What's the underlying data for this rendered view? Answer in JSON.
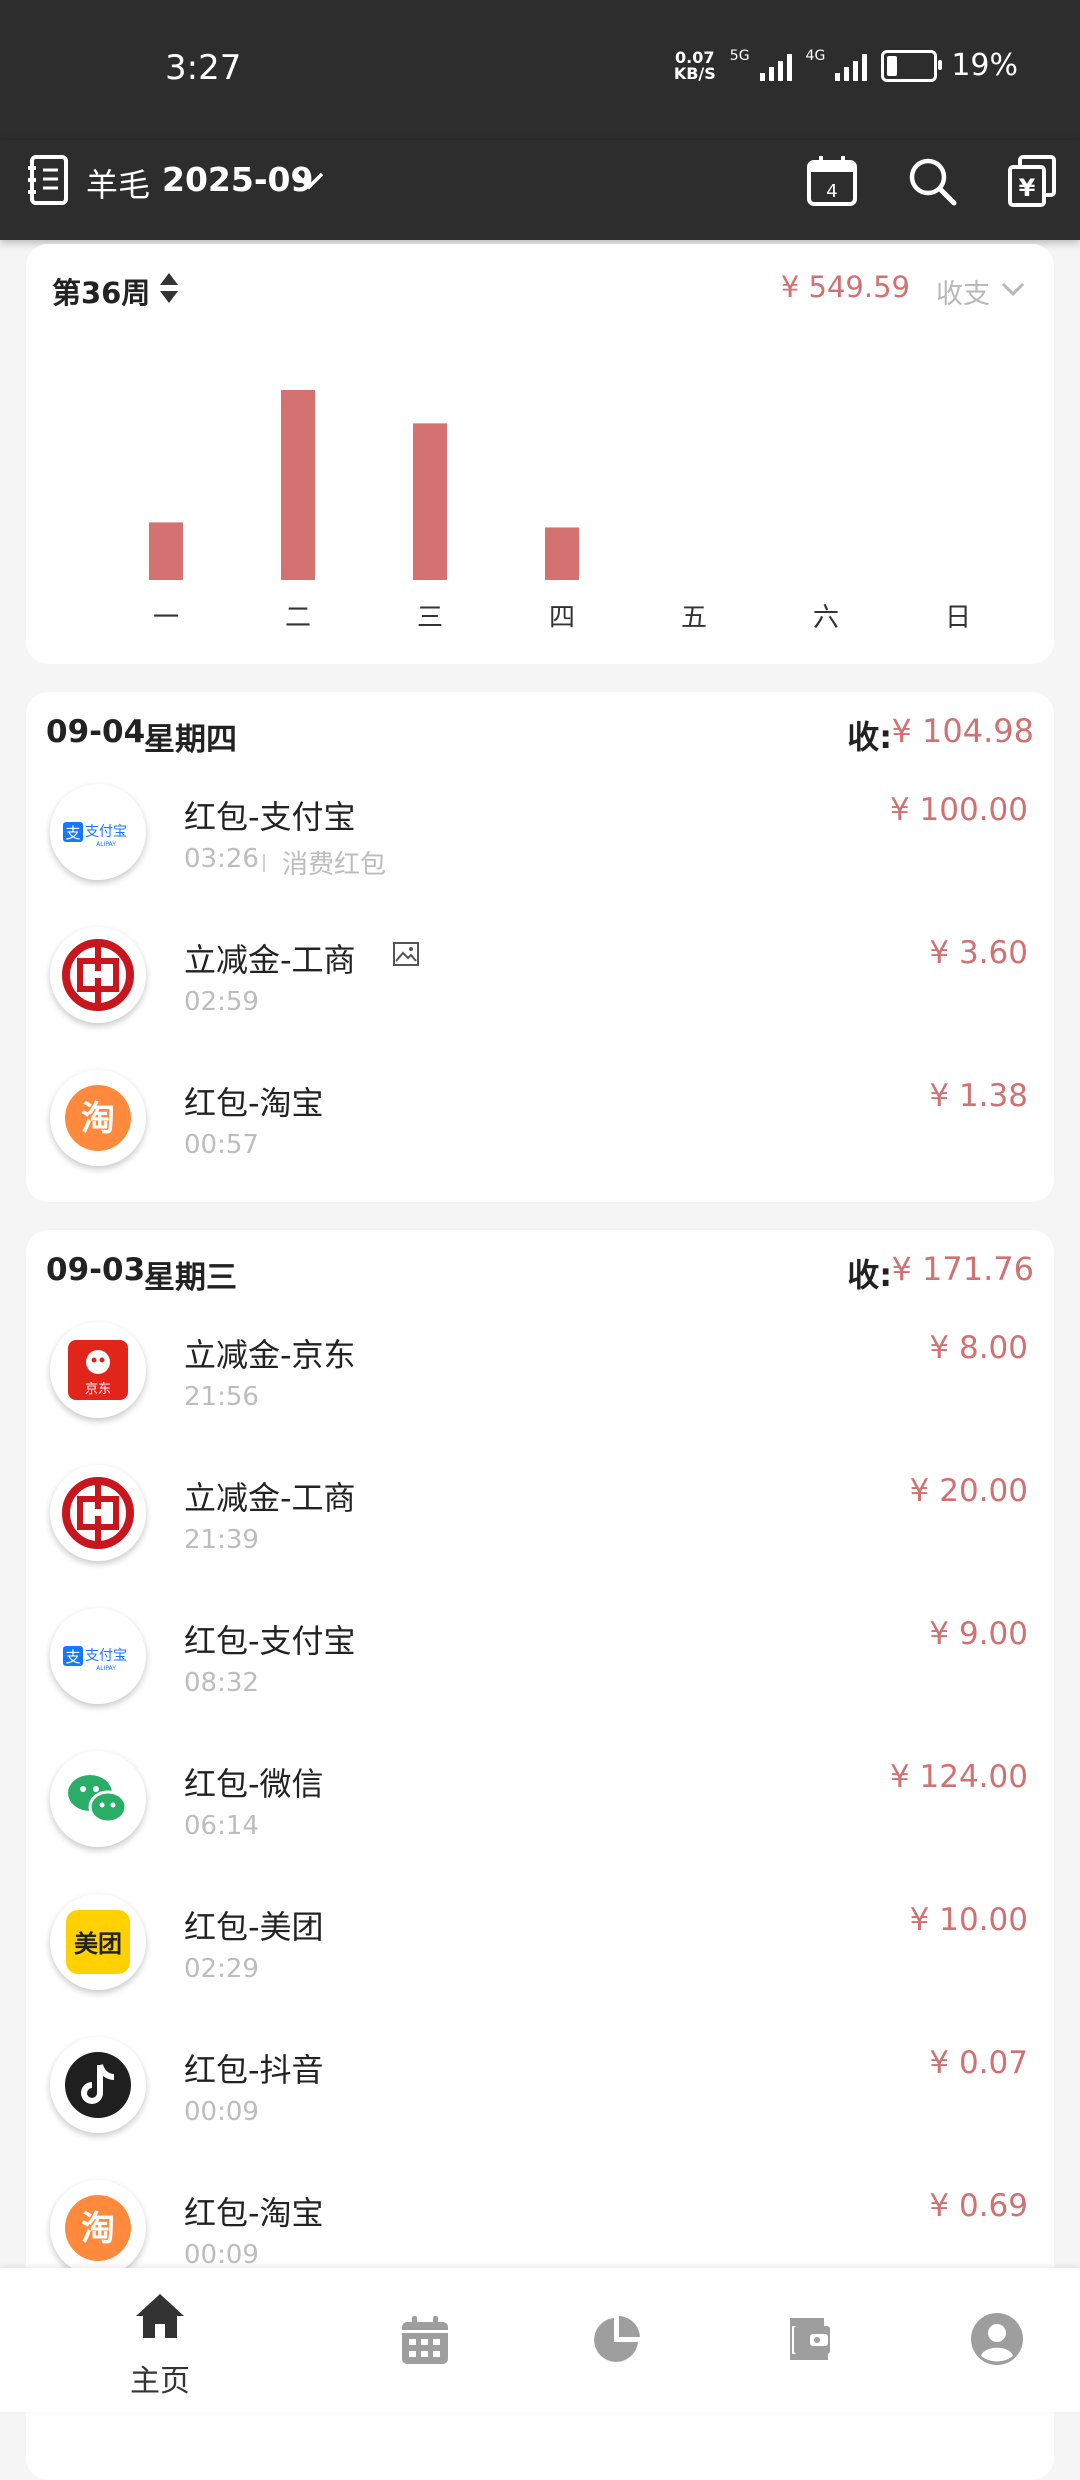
{
  "status": {
    "time": "3:27",
    "net_speed_value": "0.07",
    "net_speed_unit": "KB/S",
    "sig1": "5G",
    "sig2": "4G",
    "battery": "19%"
  },
  "header": {
    "book": "羊毛",
    "month": "2025-09",
    "calendar_day": "4"
  },
  "week": {
    "label": "第36周",
    "total": "¥ 549.59",
    "mode": "收支",
    "days": [
      "一",
      "二",
      "三",
      "四",
      "五",
      "六",
      "日"
    ],
    "bar_color": "#d47272"
  },
  "chart_data": {
    "type": "bar",
    "categories": [
      "一",
      "二",
      "三",
      "四",
      "五",
      "六",
      "日"
    ],
    "values": [
      57,
      188,
      155,
      52,
      0,
      0,
      0
    ]
  },
  "groups": [
    {
      "date": "09-04",
      "weekday": "星期四",
      "income_label": "收:",
      "income": "¥ 104.98",
      "items": [
        {
          "icon": "alipay-icon",
          "title": "红包-支付宝",
          "time": "03:26",
          "note": "消费红包",
          "amount": "¥ 100.00"
        },
        {
          "icon": "icbc-icon",
          "title": "立减金-工商",
          "time": "02:59",
          "amount": "¥ 3.60",
          "has_image": true
        },
        {
          "icon": "taobao-icon",
          "title": "红包-淘宝",
          "time": "00:57",
          "amount": "¥ 1.38"
        }
      ]
    },
    {
      "date": "09-03",
      "weekday": "星期三",
      "income_label": "收:",
      "income": "¥ 171.76",
      "items": [
        {
          "icon": "jd-icon",
          "title": "立减金-京东",
          "time": "21:56",
          "amount": "¥ 8.00"
        },
        {
          "icon": "icbc-icon",
          "title": "立减金-工商",
          "time": "21:39",
          "amount": "¥ 20.00"
        },
        {
          "icon": "alipay-icon",
          "title": "红包-支付宝",
          "time": "08:32",
          "amount": "¥ 9.00"
        },
        {
          "icon": "wechat-icon",
          "title": "红包-微信",
          "time": "06:14",
          "amount": "¥ 124.00"
        },
        {
          "icon": "meituan-icon",
          "title": "红包-美团",
          "time": "02:29",
          "amount": "¥ 10.00"
        },
        {
          "icon": "douyin-icon",
          "title": "红包-抖音",
          "time": "00:09",
          "amount": "¥ 0.07"
        },
        {
          "icon": "taobao-icon",
          "title": "红包-淘宝",
          "time": "00:09",
          "amount": "¥ 0.69"
        }
      ]
    }
  ],
  "logos": {
    "alipay": "支付宝",
    "alipay_en": "ALIPAY",
    "jd": "京东",
    "meituan": "美团",
    "taobao": "淘"
  },
  "nav": {
    "home": "主页"
  },
  "colors": {
    "accent": "#d17171",
    "dark": "#2d2d2d",
    "alipay": "#1677ff",
    "icbc": "#c7161e",
    "taobao": "#ff8a3d",
    "jd": "#e1251b",
    "wechat": "#2aae67",
    "meituan": "#ffd100"
  }
}
